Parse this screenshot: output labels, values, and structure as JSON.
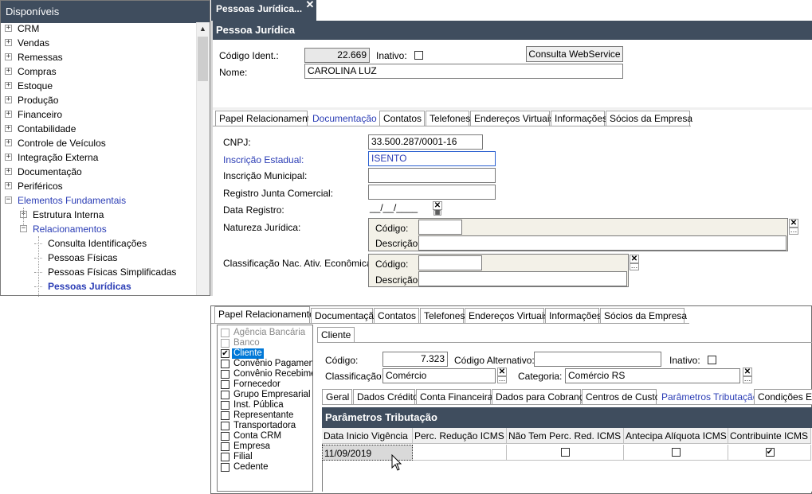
{
  "sidebar": {
    "title": "Disponíveis",
    "items": [
      {
        "label": "CRM",
        "expander": "+"
      },
      {
        "label": "Vendas",
        "expander": "+"
      },
      {
        "label": "Remessas",
        "expander": "+"
      },
      {
        "label": "Compras",
        "expander": "+"
      },
      {
        "label": "Estoque",
        "expander": "+"
      },
      {
        "label": "Produção",
        "expander": "+"
      },
      {
        "label": "Financeiro",
        "expander": "+"
      },
      {
        "label": "Contabilidade",
        "expander": "+"
      },
      {
        "label": "Controle de Veículos",
        "expander": "+"
      },
      {
        "label": "Integração Externa",
        "expander": "+"
      },
      {
        "label": "Documentação",
        "expander": "+"
      },
      {
        "label": "Periféricos",
        "expander": "+"
      },
      {
        "label": "Elementos Fundamentais",
        "expander": "-"
      },
      {
        "label": "Estrutura Interna",
        "expander": "+"
      },
      {
        "label": "Relacionamentos",
        "expander": "-"
      },
      {
        "label": "Consulta Identificações"
      },
      {
        "label": "Pessoas Físicas"
      },
      {
        "label": "Pessoas Físicas Simplificadas"
      },
      {
        "label": "Pessoas Jurídicas"
      }
    ]
  },
  "document_tab": {
    "label": "Pessoas Jurídica...",
    "close": "✕"
  },
  "panel_title": "Pessoa Jurídica",
  "header_form": {
    "codigo_label": "Código Ident.:",
    "codigo_value": "22.669",
    "inativo_label": "Inativo:",
    "webservice_button": "Consulta WebService",
    "nome_label": "Nome:",
    "nome_value": "CAROLINA  LUZ"
  },
  "top_tabs": [
    "Papel Relacionamento",
    "Documentação",
    "Contatos",
    "Telefones",
    "Endereços Virtuais",
    "Informações",
    "Sócios da Empresa"
  ],
  "documentacao": {
    "cnpj_label": "CNPJ:",
    "cnpj_value": "33.500.287/0001-16",
    "ie_label": "Inscrição Estadual:",
    "ie_value": "ISENTO",
    "im_label": "Inscrição Municipal:",
    "rjc_label": "Registro Junta Comercial:",
    "data_registro_label": "Data Registro:",
    "data_registro_value": "__/__/____",
    "natureza_label": "Natureza Jurídica:",
    "codigo_label": "Código:",
    "descricao_label": "Descrição:",
    "cnae_label": "Classificação Nac. Ativ. Econômicas:"
  },
  "bottom_tabs": [
    "Papel Relacionamento",
    "Documentação",
    "Contatos",
    "Telefones",
    "Endereços Virtuais",
    "Informações",
    "Sócios da Empresa"
  ],
  "roles": [
    {
      "label": "Agência Bancária",
      "checked": false,
      "disabled": true
    },
    {
      "label": "Banco",
      "checked": false,
      "disabled": true
    },
    {
      "label": "Cliente",
      "checked": true,
      "selected": true
    },
    {
      "label": "Convênio Pagamento",
      "checked": false
    },
    {
      "label": "Convênio Recebimento",
      "checked": false
    },
    {
      "label": "Fornecedor",
      "checked": false
    },
    {
      "label": "Grupo Empresarial",
      "checked": false
    },
    {
      "label": "Inst. Pública",
      "checked": false
    },
    {
      "label": "Representante",
      "checked": false
    },
    {
      "label": "Transportadora",
      "checked": false
    },
    {
      "label": "Conta CRM",
      "checked": false
    },
    {
      "label": "Empresa",
      "checked": false
    },
    {
      "label": "Filial",
      "checked": false
    },
    {
      "label": "Cedente",
      "checked": false
    }
  ],
  "cliente": {
    "tab_label": "Cliente",
    "codigo_label": "Código:",
    "codigo_value": "7.323",
    "codigo_alt_label": "Código Alternativo:",
    "inativo_label": "Inativo:",
    "classificacao_label": "Classificação:",
    "classificacao_value": "Comércio",
    "categoria_label": "Categoria:",
    "categoria_value": "Comércio RS"
  },
  "cliente_tabs": [
    "Geral",
    "Dados Crédito",
    "Conta Financeira",
    "Dados para Cobrança",
    "Centros de Custo",
    "Parâmetros Tributação",
    "Condições Esp"
  ],
  "grid": {
    "title": "Parâmetros Tributação",
    "columns": [
      "Data Inicio Vigência",
      "Perc. Redução ICMS",
      "Não Tem Perc. Red. ICMS",
      "Antecipa Alíquota ICMS",
      "Contribuinte ICMS"
    ],
    "rows": [
      {
        "data_inicio": "11/09/2019",
        "perc_reducao": "",
        "nao_tem_perc": false,
        "antecipa": false,
        "contribuinte": true
      }
    ]
  }
}
